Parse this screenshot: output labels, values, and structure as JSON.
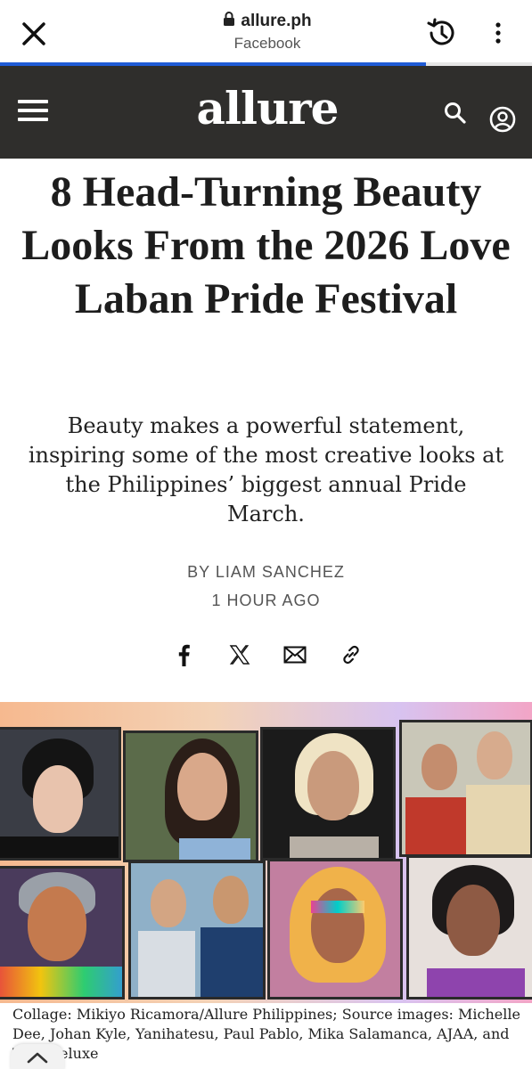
{
  "browser": {
    "url": "allure.ph",
    "referrer": "Facebook",
    "load_progress": 0.8
  },
  "site": {
    "logo": "allure"
  },
  "article": {
    "headline": "8 Head-Turning Beauty Looks From the 2026 Love Laban Pride Festival",
    "dek": "Beauty makes a powerful statement, inspiring some of the most creative looks at the Philippines’ biggest annual Pride March.",
    "byline": "BY LIAM SANCHEZ",
    "timestamp": "1 HOUR AGO",
    "share": [
      "facebook-icon",
      "x-icon",
      "email-icon",
      "link-icon"
    ],
    "caption": "Collage: Mikiyo Ricamora/Allure Philippines; Source images: Michelle Dee, Johan Kyle, Yanihatesu, Paul Pablo, Mika Salamanca, AJAA, and Tiny Deluxe"
  },
  "colors": {
    "header_bg": "#2f2e2c",
    "progress": "#1f5bd6"
  }
}
